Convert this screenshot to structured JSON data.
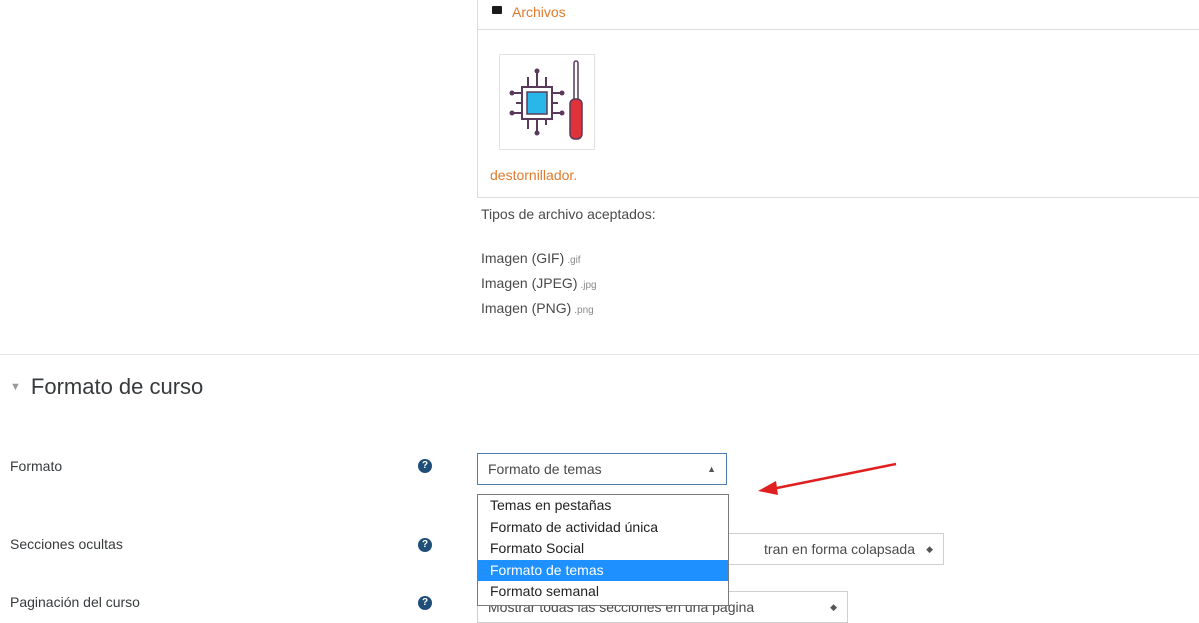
{
  "file_manager": {
    "folder_label": "Archivos",
    "file_name": "destornillador."
  },
  "accepted": {
    "title": "Tipos de archivo aceptados:",
    "types": [
      {
        "name": "Imagen (GIF)",
        "ext": ".gif"
      },
      {
        "name": "Imagen (JPEG)",
        "ext": ".jpg"
      },
      {
        "name": "Imagen (PNG)",
        "ext": ".png"
      }
    ]
  },
  "section": {
    "title": "Formato de curso"
  },
  "fields": {
    "formato": {
      "label": "Formato",
      "value": "Formato de temas",
      "options": [
        "Temas en pestañas",
        "Formato de actividad única",
        "Formato Social",
        "Formato de temas",
        "Formato semanal"
      ],
      "selected_index": 3
    },
    "secciones": {
      "label": "Secciones ocultas",
      "value_visible": "tran en forma colapsada"
    },
    "paginacion": {
      "label": "Paginación del curso",
      "value_visible": "Mostrar todas las secciones en una página"
    }
  },
  "colors": {
    "link": "#e27a2d",
    "help_icon": "#1f4e79",
    "selected_option": "#1e90ff",
    "annotation_arrow": "#e02020"
  }
}
